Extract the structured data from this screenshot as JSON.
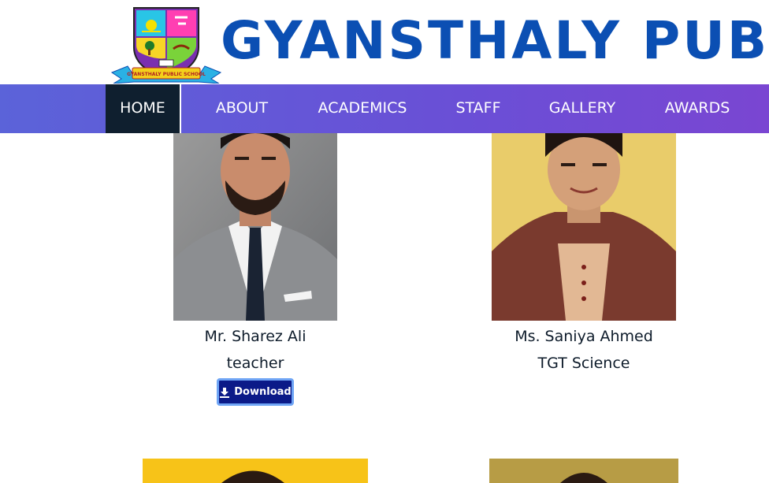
{
  "header": {
    "title": "GYANSTHALY PUBLIC SCHOOL",
    "logo_ribbon_text": "GYANSTHALY PUBLIC SCHOOL"
  },
  "nav": {
    "items": [
      {
        "label": "HOME",
        "active": true
      },
      {
        "label": "ABOUT"
      },
      {
        "label": "ACADEMICS"
      },
      {
        "label": "STAFF"
      },
      {
        "label": "GALLERY"
      },
      {
        "label": "AWARDS"
      }
    ]
  },
  "staff": [
    {
      "name": "Mr. Sharez Ali",
      "role": "teacher",
      "download_label": "Download"
    },
    {
      "name": "Ms. Saniya Ahmed",
      "role": "TGT Science"
    }
  ],
  "colors": {
    "nav_gradient_start": "#5b63d9",
    "nav_gradient_end": "#7a46d2",
    "nav_active": "#0f1f2f",
    "title_blue": "#0b4fb3",
    "download_bg": "#0b1a88"
  }
}
